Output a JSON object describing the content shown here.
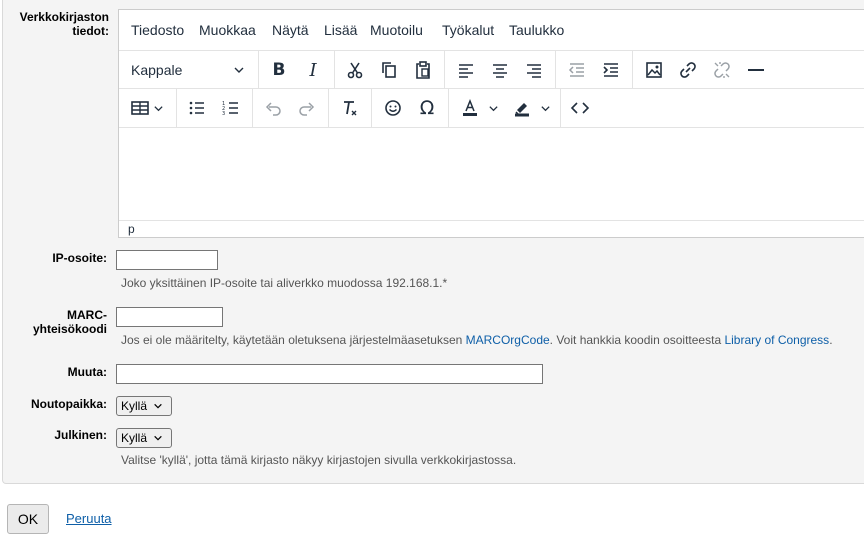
{
  "labels": {
    "library_line1": "Verkkokirjaston",
    "library_line2": "tiedot:",
    "ip": "IP-osoite:",
    "marc_line1": "MARC-",
    "marc_line2": "yhteisökoodi",
    "other": "Muuta:",
    "pickup": "Noutopaikka:",
    "public": "Julkinen:"
  },
  "editor": {
    "menu": [
      "Tiedosto",
      "Muokkaa",
      "Näytä",
      "Lisää",
      "Muotoilu",
      "Työkalut",
      "Taulukko"
    ],
    "block_format": "Kappale",
    "status_path": "p",
    "toolbar1_icons": [
      "bold-icon",
      "italic-icon",
      "cut-icon",
      "copy-icon",
      "paste-icon",
      "align-left-icon",
      "align-center-icon",
      "align-right-icon",
      "outdent-icon",
      "indent-icon",
      "image-icon",
      "link-icon",
      "unlink-icon",
      "horizontal-rule-icon"
    ],
    "toolbar2_icons": [
      "table-icon",
      "bullet-list-icon",
      "numbered-list-icon",
      "undo-icon",
      "redo-icon",
      "clear-format-icon",
      "emoji-icon",
      "omega-icon",
      "text-color-icon",
      "highlight-icon",
      "code-icon"
    ]
  },
  "ip_field": {
    "value": "",
    "hint": "Joko yksittäinen IP-osoite tai aliverkko muodossa 192.168.1.*"
  },
  "marc_field": {
    "value": "",
    "hint_before": "Jos ei ole määritelty, käytetään oletuksena järjestelmäasetuksen",
    "hint_link1": "MARCOrgCode",
    "hint_middle": ". Voit hankkia koodin osoitteesta",
    "hint_link2": "Library of Congress",
    "hint_after": "."
  },
  "other_field": {
    "value": ""
  },
  "pickup_select": {
    "selected": "Kyllä"
  },
  "public_select": {
    "selected": "Kyllä",
    "hint": "Valitse 'kyllä', jotta tämä kirjasto näkyy kirjastojen sivulla verkkokirjastossa."
  },
  "actions": {
    "ok": "OK",
    "cancel": "Peruuta"
  }
}
